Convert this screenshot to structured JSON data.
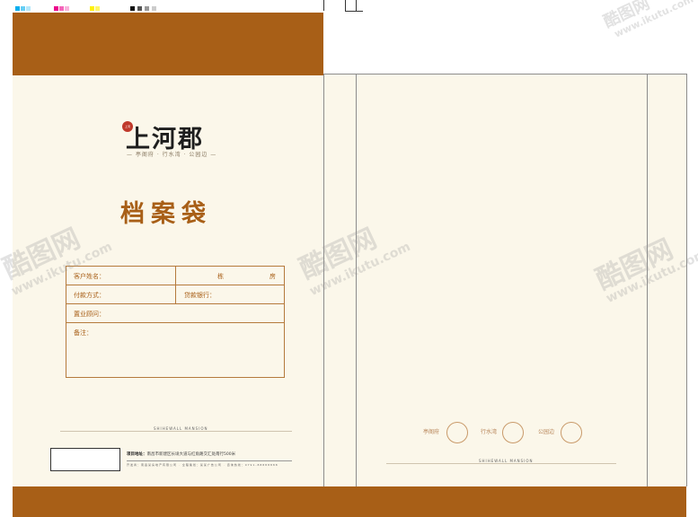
{
  "front": {
    "logo_text": "上河郡",
    "logo_seal": "上河",
    "tagline": "— 亭阁府 · 行水湾 · 公园边 —",
    "title": "档案袋",
    "form": {
      "customer_name_label": "客户姓名：",
      "building_label": "栋",
      "room_label": "房",
      "payment_label": "付款方式：",
      "bank_label": "贷款银行：",
      "consultant_label": "置业顾问：",
      "remarks_label": "备注："
    },
    "footer_brand": "SHIHEWALL MANSION",
    "address_label": "项目地址：",
    "address_text": "南昌市新建区长堎大道与红角路交汇处南行500米",
    "footer_small": "开发商：南昌某房地产有限公司 · 全程策划：某某广告公司 · 咨询热线：0791-88888888"
  },
  "back": {
    "seals": [
      {
        "label": "亭阁府"
      },
      {
        "label": "行水湾"
      },
      {
        "label": "公园边"
      }
    ],
    "footer_brand": "SHIHEWALL MANSION"
  },
  "watermark": {
    "brand": "酷图网",
    "url": "www.ikutu.com"
  },
  "colors": {
    "brown": "#a85f17",
    "paper": "#fbf7ea"
  }
}
